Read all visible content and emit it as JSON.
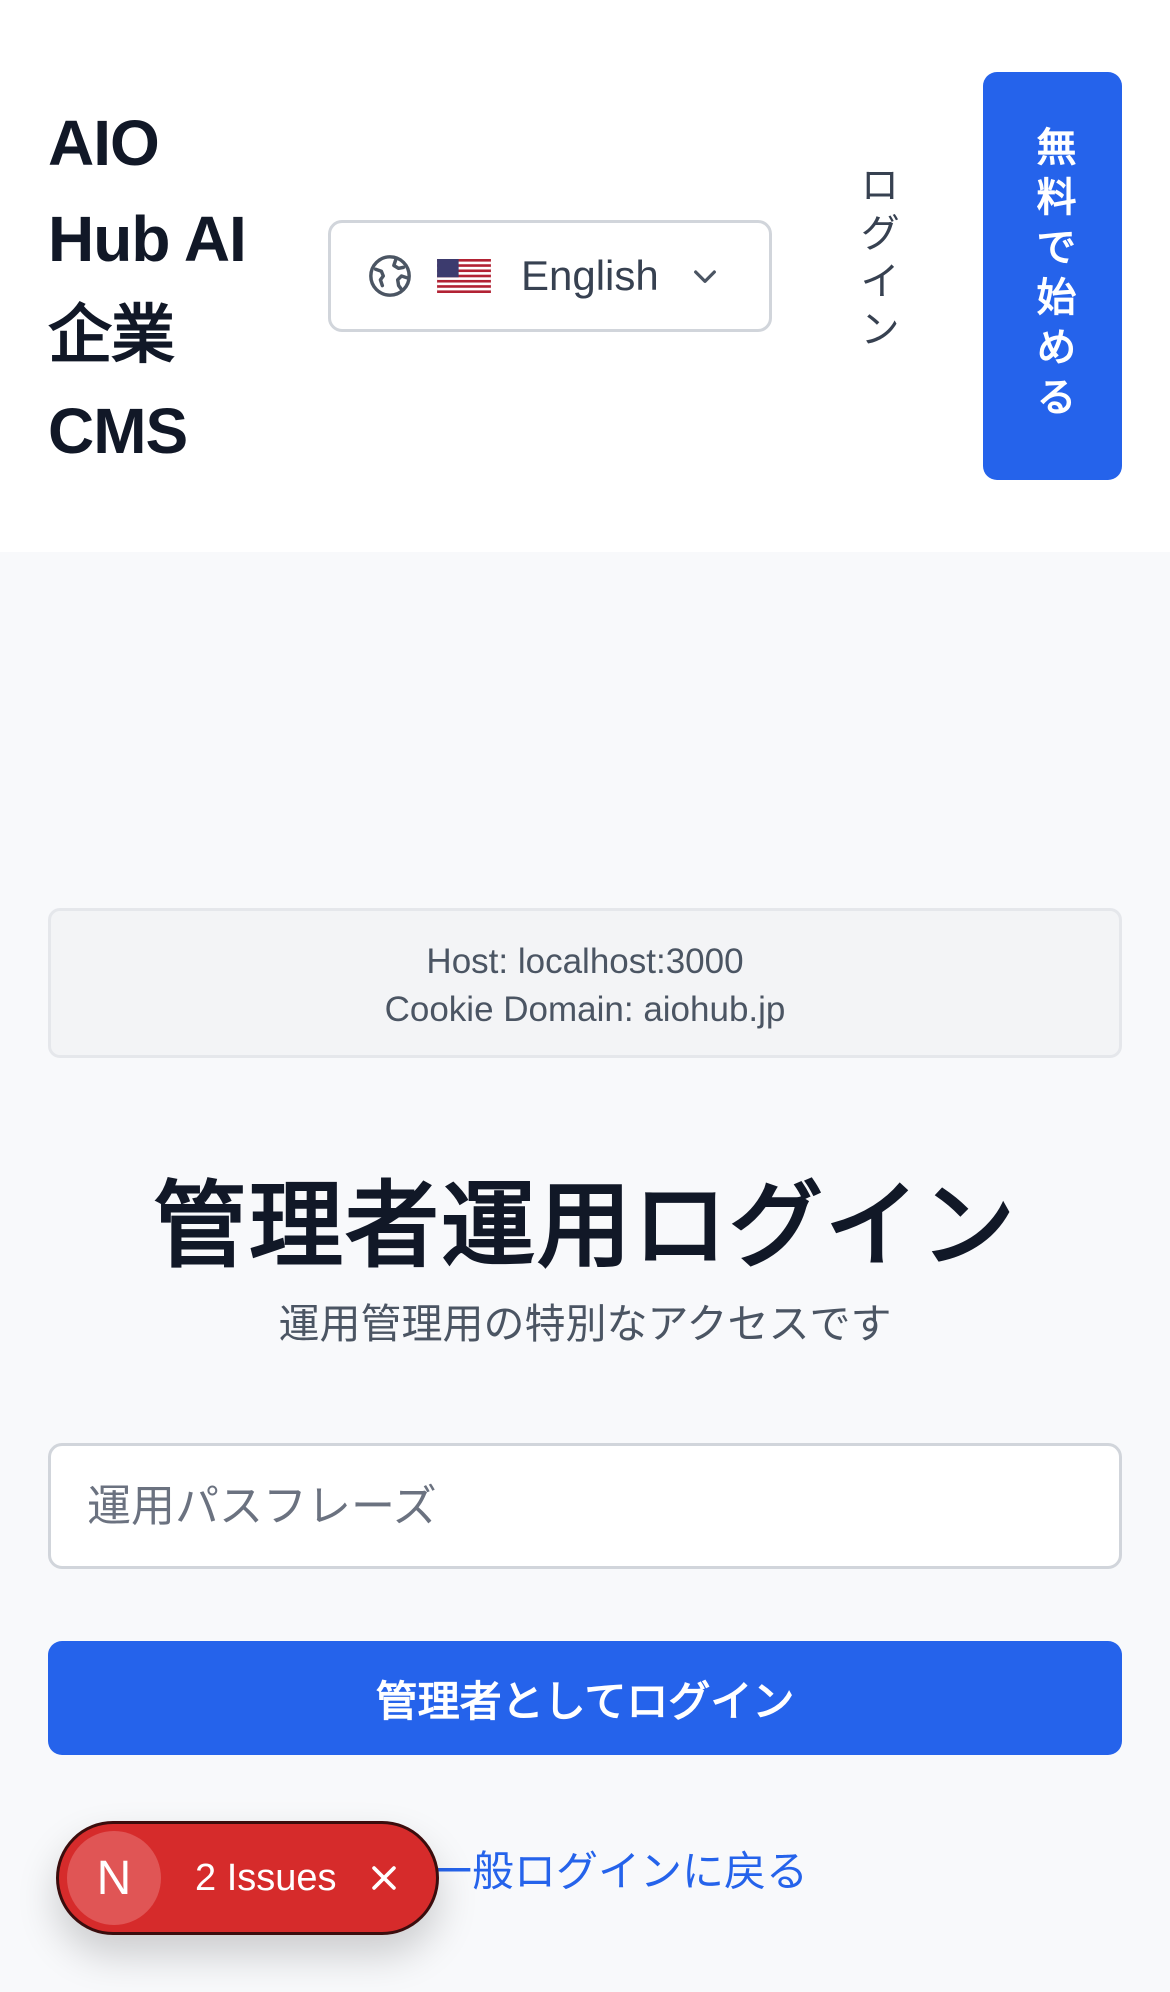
{
  "header": {
    "brand_lines": [
      "AIO",
      "Hub AI",
      "企業",
      "CMS"
    ],
    "language": {
      "flag": "🇺🇸",
      "label": "English"
    },
    "login_label": "ログイン",
    "start_label": "無料で始める"
  },
  "debug": {
    "host_line": "Host: localhost:3000",
    "cookie_line": "Cookie Domain: aiohub.jp"
  },
  "main": {
    "title": "管理者運用ログイン",
    "subtitle": "運用管理用の特別なアクセスです",
    "passphrase_placeholder": "運用パスフレーズ",
    "passphrase_value": "",
    "submit_label": "管理者としてログイン",
    "back_link_label": "一般ログインに戻る"
  },
  "dev_overlay": {
    "logo_letter": "N",
    "issues_label": "2 Issues"
  },
  "colors": {
    "accent": "#2563eb",
    "issues_badge": "#d62b2b"
  }
}
